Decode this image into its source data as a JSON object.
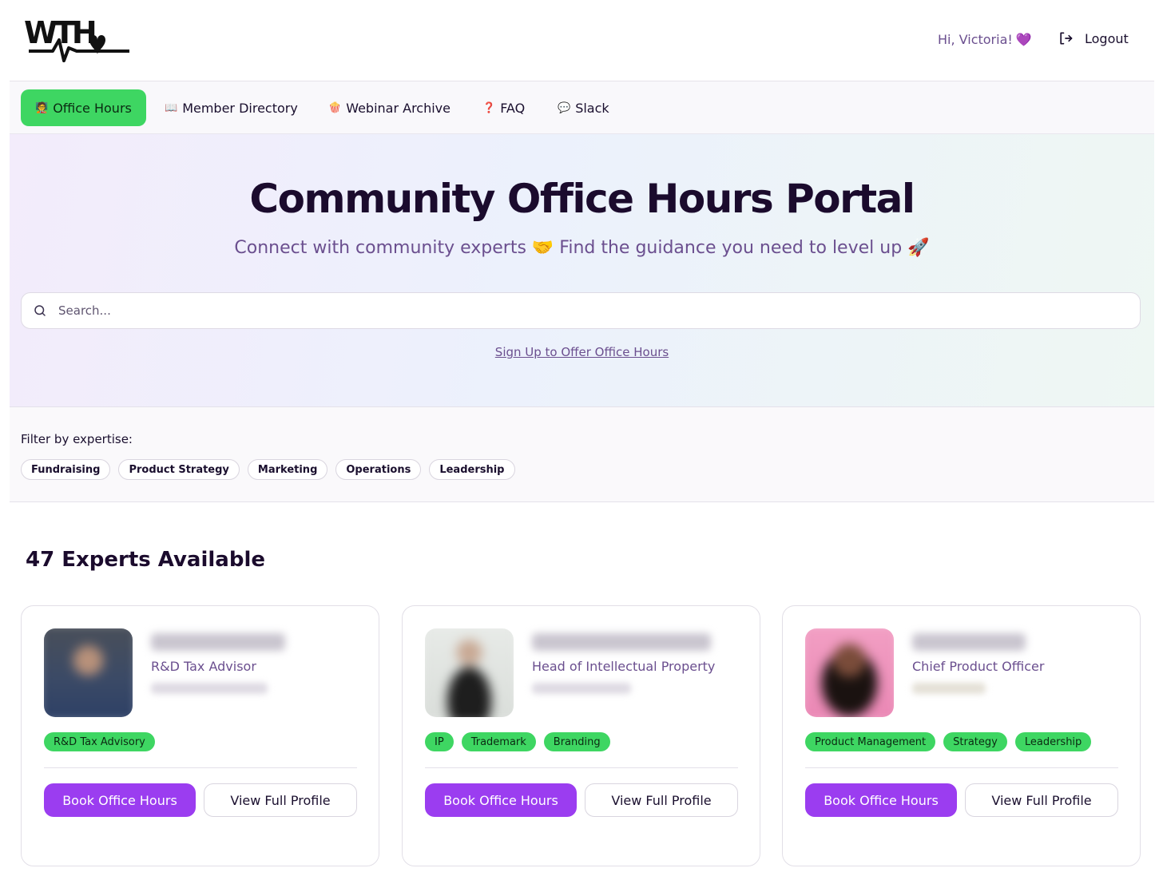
{
  "header": {
    "logo_text": "WTH",
    "greeting": "Hi, Victoria!",
    "greeting_emoji": "💜",
    "logout_label": "Logout",
    "logout_icon": "logout-icon"
  },
  "nav": {
    "items": [
      {
        "icon": "🧑‍🏫",
        "label": "Office Hours",
        "active": true
      },
      {
        "icon": "📖",
        "label": "Member Directory",
        "active": false
      },
      {
        "icon": "🍿",
        "label": "Webinar Archive",
        "active": false
      },
      {
        "icon": "❓",
        "label": "FAQ",
        "active": false
      },
      {
        "icon": "💬",
        "label": "Slack",
        "active": false
      }
    ]
  },
  "hero": {
    "title": "Community Office Hours Portal",
    "subtitle": "Connect with community experts 🤝 Find the guidance you need to level up 🚀",
    "search_placeholder": "Search...",
    "signup_link": "Sign Up to Offer Office Hours"
  },
  "filters": {
    "label": "Filter by expertise:",
    "chips": [
      "Fundraising",
      "Product Strategy",
      "Marketing",
      "Operations",
      "Leadership"
    ]
  },
  "experts": {
    "count_title": "47 Experts Available",
    "cards": [
      {
        "title": "R&D Tax Advisor",
        "tags": [
          "R&D Tax Advisory"
        ],
        "book_label": "Book Office Hours",
        "profile_label": "View Full Profile"
      },
      {
        "title": "Head of Intellectual Property",
        "tags": [
          "IP",
          "Trademark",
          "Branding"
        ],
        "book_label": "Book Office Hours",
        "profile_label": "View Full Profile"
      },
      {
        "title": "Chief Product Officer",
        "tags": [
          "Product Management",
          "Strategy",
          "Leadership"
        ],
        "book_label": "Book Office Hours",
        "profile_label": "View Full Profile"
      }
    ]
  },
  "colors": {
    "accent_green": "#3ed662",
    "accent_purple": "#9b3df0",
    "muted_purple": "#6b4f8f",
    "ink": "#1b0b2d"
  }
}
